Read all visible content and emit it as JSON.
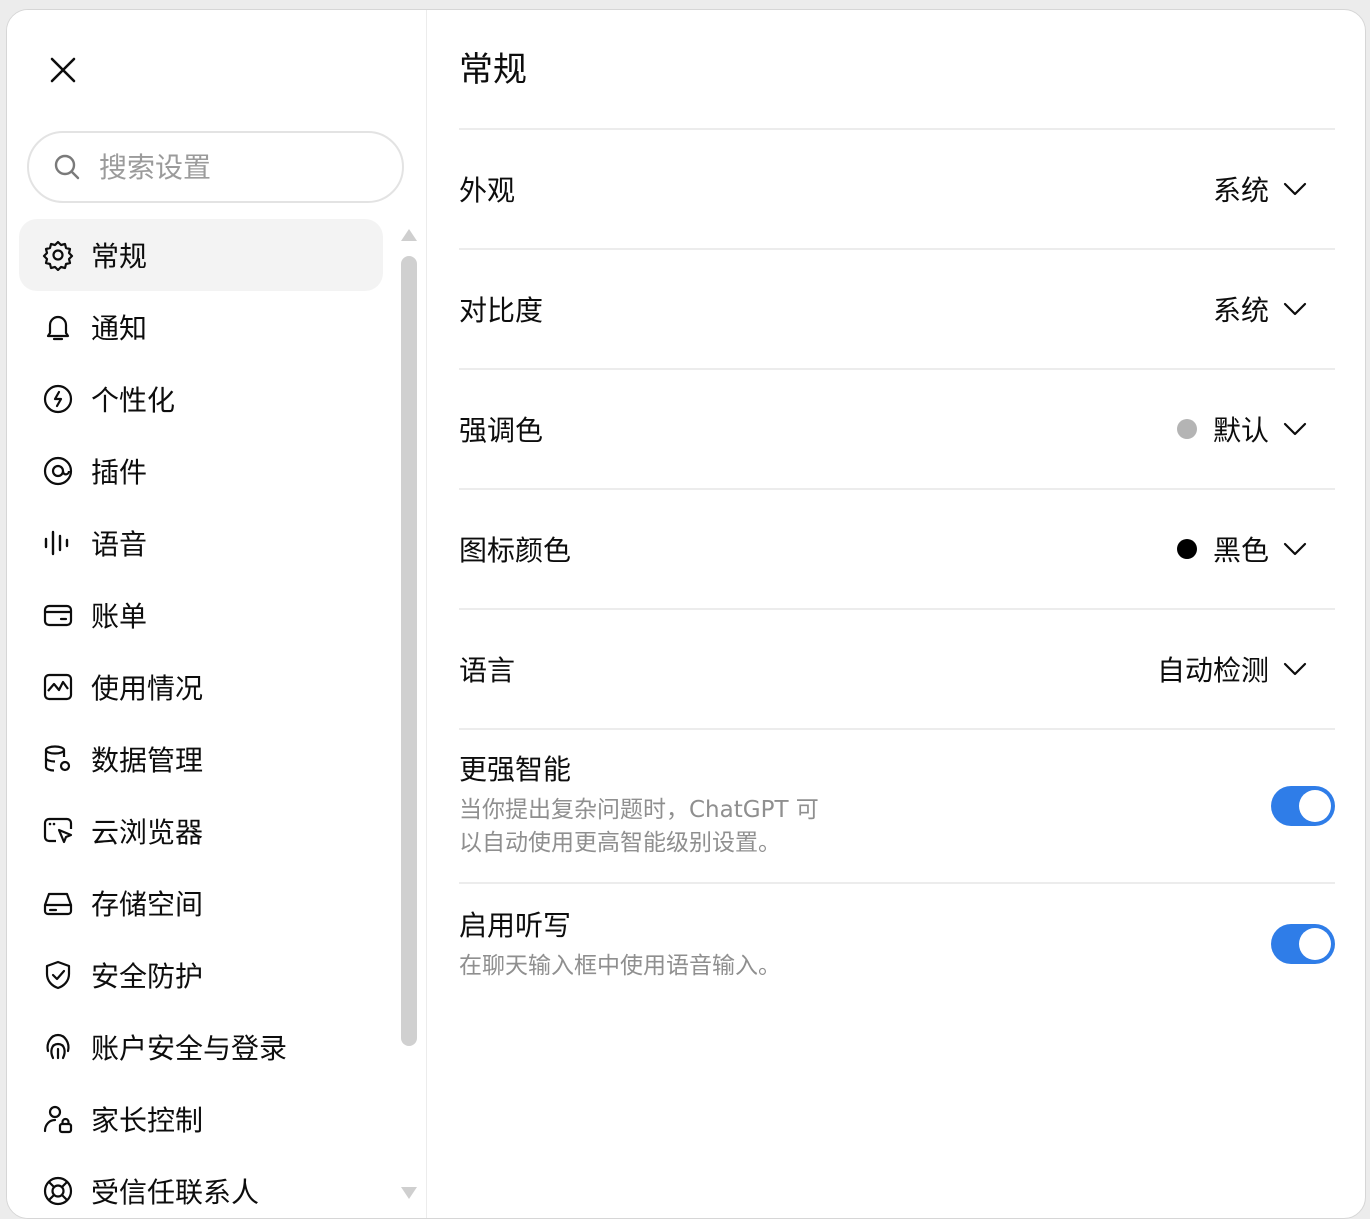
{
  "sidebar": {
    "search_placeholder": "搜索设置",
    "items": [
      {
        "label": "常规",
        "icon": "gear-icon",
        "active": true
      },
      {
        "label": "通知",
        "icon": "bell-icon"
      },
      {
        "label": "个性化",
        "icon": "personalization-icon"
      },
      {
        "label": "插件",
        "icon": "plugin-icon"
      },
      {
        "label": "语音",
        "icon": "voice-waveform-icon"
      },
      {
        "label": "账单",
        "icon": "card-icon"
      },
      {
        "label": "使用情况",
        "icon": "usage-chart-icon"
      },
      {
        "label": "数据管理",
        "icon": "database-gear-icon"
      },
      {
        "label": "云浏览器",
        "icon": "cloud-browser-icon"
      },
      {
        "label": "存储空间",
        "icon": "storage-drive-icon"
      },
      {
        "label": "安全防护",
        "icon": "shield-check-icon"
      },
      {
        "label": "账户安全与登录",
        "icon": "fingerprint-icon"
      },
      {
        "label": "家长控制",
        "icon": "user-lock-icon"
      },
      {
        "label": "受信任联系人",
        "icon": "lifebuoy-icon"
      }
    ]
  },
  "main": {
    "title": "常规",
    "rows": {
      "appearance": {
        "label": "外观",
        "value": "系统"
      },
      "contrast": {
        "label": "对比度",
        "value": "系统"
      },
      "accent": {
        "label": "强调色",
        "value": "默认",
        "dot_color": "#b4b4b4"
      },
      "icon_color": {
        "label": "图标颜色",
        "value": "黑色",
        "dot_color": "#000000"
      },
      "language": {
        "label": "语言",
        "value": "自动检测"
      }
    },
    "toggles": {
      "smarter": {
        "title": "更强智能",
        "description": "当你提出复杂问题时，ChatGPT 可以自动使用更高智能级别设置。",
        "on": true
      },
      "dictation": {
        "title": "启用听写",
        "description": "在聊天输入框中使用语音输入。",
        "on": true
      }
    }
  },
  "colors": {
    "toggle_on": "#2f7de8",
    "divider": "#ececec",
    "muted_text": "#8f8f8f"
  }
}
